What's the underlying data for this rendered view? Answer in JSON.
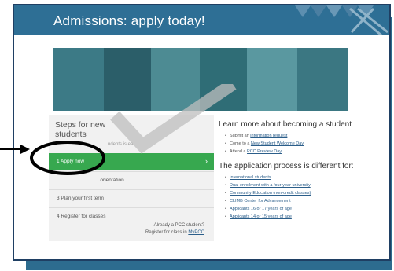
{
  "header": {
    "title": "Admissions: apply today!"
  },
  "steps": {
    "title_line1": "Steps for new",
    "title_line2": "students",
    "hidden_step_fragment": "...udents is ea...",
    "items": [
      {
        "label": "1  Apply now",
        "active": true
      },
      {
        "label": "...orientation"
      },
      {
        "label": "3  Plan your first term"
      },
      {
        "label": "4  Register for classes"
      }
    ],
    "already_line1": "Already a PCC student?",
    "already_line2_prefix": "Register for class in ",
    "already_link": "MyPCC"
  },
  "learn_more": {
    "heading": "Learn more about becoming a student",
    "items": [
      {
        "prefix": "Submit an ",
        "link": "information request"
      },
      {
        "prefix": "Come to a ",
        "link": "New Student Welcome Day"
      },
      {
        "prefix": "Attend a ",
        "link": "PCC Preview Day"
      }
    ]
  },
  "process": {
    "heading": "The application process is different for:",
    "items": [
      "International students",
      "Dual enrollment with a four-year university",
      "Community Education (non-credit classes)",
      "CLIMB Center for Advancement",
      "Applicants 16 or 17 years of age",
      "Applicants 14 or 15 years of age"
    ]
  },
  "colors": {
    "header_bg": "#2e6f95",
    "active_step": "#37a84f",
    "frame_shadow": "#2d6c8f",
    "link": "#2b5e8a"
  }
}
